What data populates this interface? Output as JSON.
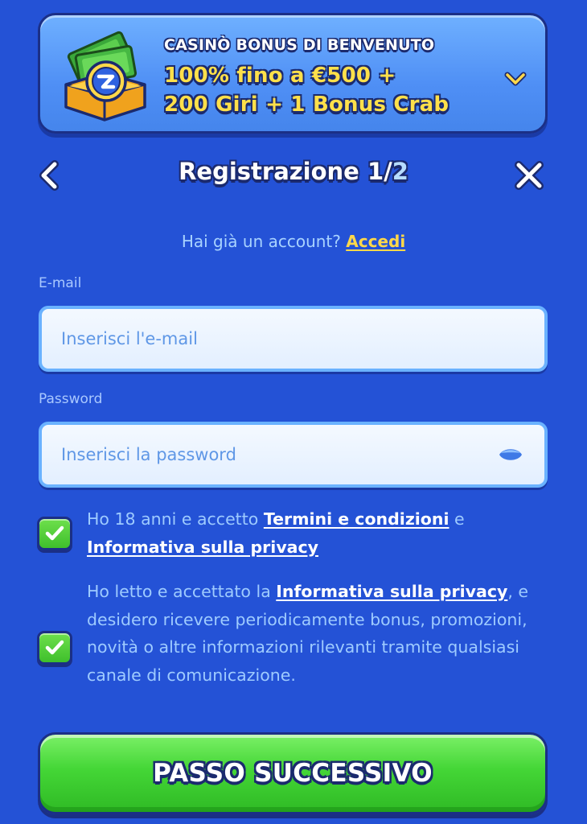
{
  "bonus_banner": {
    "kicker": "CASINÒ BONUS DI BENVENUTO",
    "line1": "100% fino a €500 +",
    "line2": "200 Giri + 1 Bonus Crab",
    "image": "money-chest-icon",
    "toggle_icon": "chevron-down-icon"
  },
  "header": {
    "title_prefix": "Registrazione 1/",
    "title_total": "2",
    "back_icon": "chevron-left-icon",
    "close_icon": "close-icon"
  },
  "login_prompt": {
    "text": "Hai già un account?",
    "link": "Accedi"
  },
  "form": {
    "email": {
      "label": "E-mail",
      "placeholder": "Inserisci l'e-mail",
      "value": ""
    },
    "password": {
      "label": "Password",
      "placeholder": "Inserisci la password",
      "value": "",
      "toggle_icon": "eye-icon"
    }
  },
  "consents": [
    {
      "checked": true,
      "text_before": "Ho 18 anni e accetto",
      "link1": "Termini e condizioni",
      "text_middle": "e",
      "link2": "Informativa sulla privacy"
    },
    {
      "checked": true,
      "text_before": "Ho letto e accettato la",
      "link": "Informativa sulla privacy",
      "text_after": ", e desidero ricevere periodicamente bonus, promozioni, novità o altre informazioni rilevanti tramite qualsiasi canale di comunicazione."
    }
  ],
  "cta": {
    "label": "PASSO SUCCESSIVO"
  },
  "colors": {
    "background": "#2452d6",
    "accent_yellow": "#ffd84a",
    "cta_green": "#44d636",
    "text_light_blue": "#9ecbff"
  }
}
